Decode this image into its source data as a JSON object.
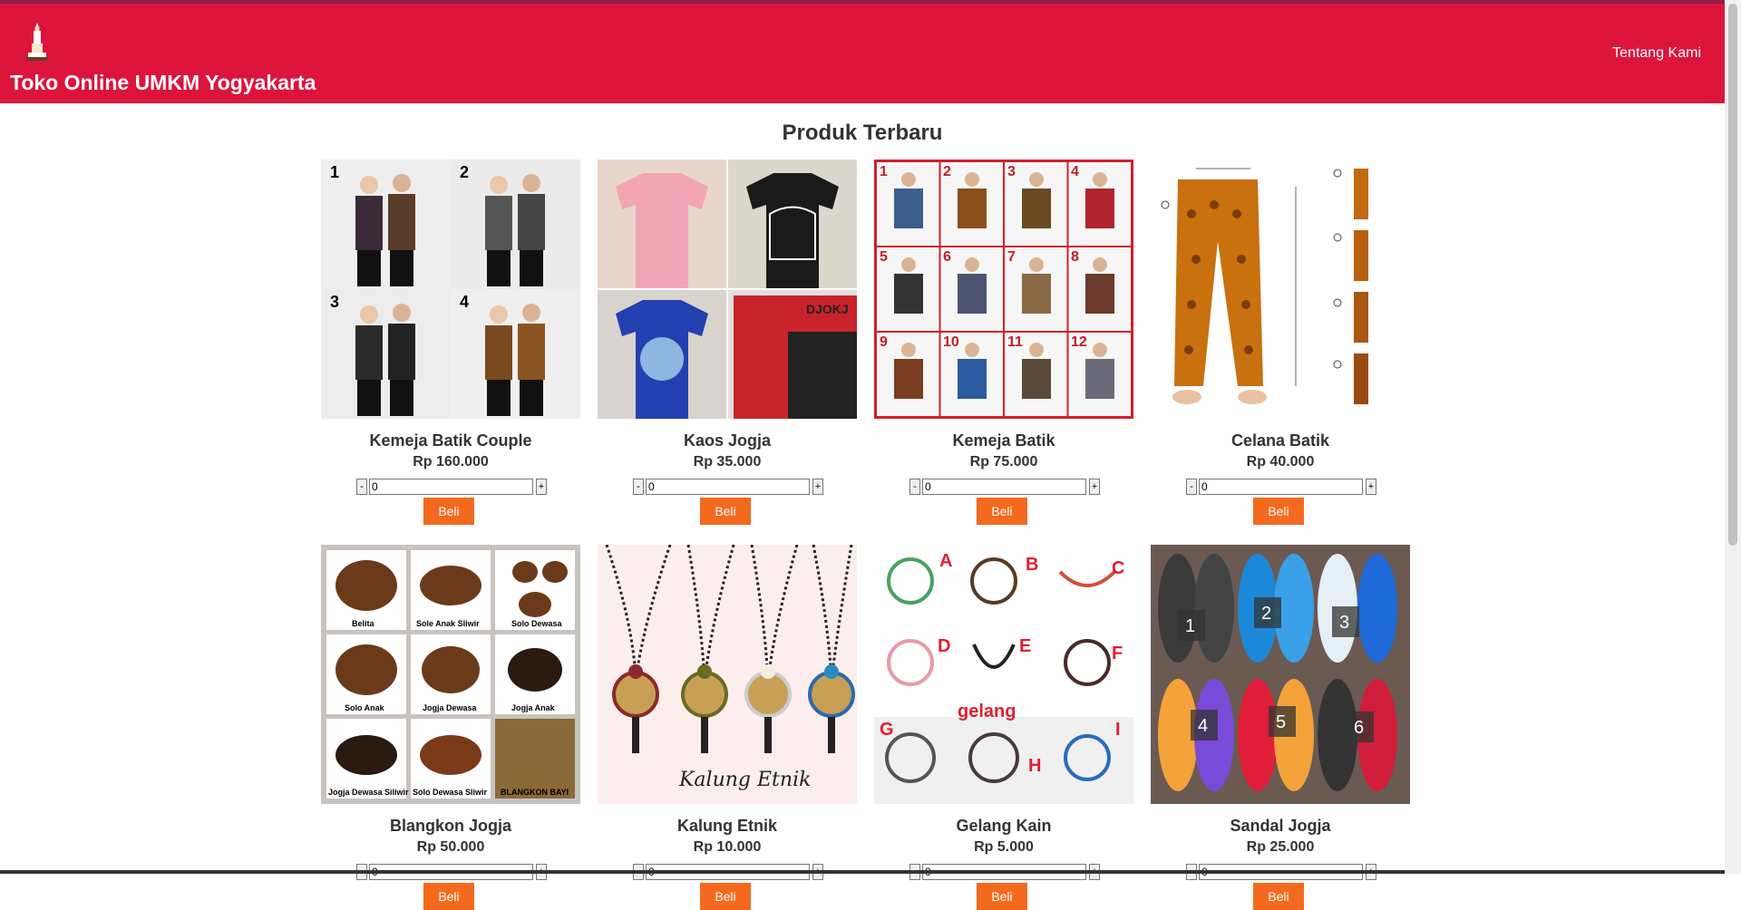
{
  "header": {
    "title": "Toko Online UMKM Yogyakarta",
    "nav_about": "Tentang Kami",
    "background_color": "#dc143c",
    "logo_icon": "tugu-monument-icon"
  },
  "main": {
    "section_title": "Produk Terbaru"
  },
  "products": [
    {
      "name": "Kemeja Batik Couple",
      "price": "Rp 160.000",
      "qty": "0",
      "buy_label": "Beli",
      "minus": "-",
      "plus": "+",
      "image_labels": [
        "1",
        "2",
        "3",
        "4"
      ]
    },
    {
      "name": "Kaos Jogja",
      "price": "Rp 35.000",
      "qty": "0",
      "buy_label": "Beli",
      "minus": "-",
      "plus": "+"
    },
    {
      "name": "Kemeja Batik",
      "price": "Rp 75.000",
      "qty": "0",
      "buy_label": "Beli",
      "minus": "-",
      "plus": "+",
      "image_labels": [
        "1",
        "2",
        "3",
        "4",
        "5",
        "6",
        "7",
        "8",
        "9",
        "10",
        "11",
        "12"
      ]
    },
    {
      "name": "Celana Batik",
      "price": "Rp 40.000",
      "qty": "0",
      "buy_label": "Beli",
      "minus": "-",
      "plus": "+"
    },
    {
      "name": "Blangkon Jogja",
      "price": "Rp 50.000",
      "qty": "0",
      "buy_label": "Beli",
      "minus": "-",
      "plus": "+",
      "image_labels": [
        "Belita",
        "Sole Anak Sliwir",
        "Solo Dewasa",
        "Solo Anak",
        "Jogja Dewasa",
        "Jogja Anak",
        "Jogja Dewasa Siliwir",
        "Solo Dewasa Sliwir",
        "BLANGKON BAYI"
      ]
    },
    {
      "name": "Kalung Etnik",
      "price": "Rp 10.000",
      "qty": "0",
      "buy_label": "Beli",
      "minus": "-",
      "plus": "+",
      "image_labels": [
        "Kalung Etnik"
      ]
    },
    {
      "name": "Gelang Kain",
      "price": "Rp 5.000",
      "qty": "0",
      "buy_label": "Beli",
      "minus": "-",
      "plus": "+",
      "image_labels": [
        "A",
        "B",
        "C",
        "D",
        "E",
        "F",
        "G",
        "H",
        "I",
        "gelang"
      ]
    },
    {
      "name": "Sandal Jogja",
      "price": "Rp 25.000",
      "qty": "0",
      "buy_label": "Beli",
      "minus": "-",
      "plus": "+",
      "image_labels": [
        "1",
        "2",
        "3",
        "4",
        "5",
        "6"
      ]
    }
  ],
  "colors": {
    "accent": "#dc143c",
    "buy_button": "#f36a1e"
  }
}
